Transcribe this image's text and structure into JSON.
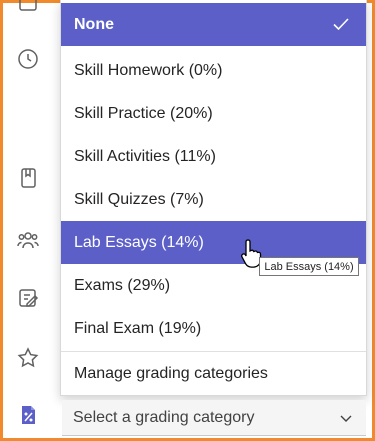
{
  "grading_menu": {
    "items": [
      {
        "label": "None",
        "state": "selected"
      },
      {
        "label": "Skill Homework (0%)",
        "state": "normal"
      },
      {
        "label": "Skill Practice (20%)",
        "state": "normal"
      },
      {
        "label": "Skill Activities (11%)",
        "state": "normal"
      },
      {
        "label": "Skill Quizzes (7%)",
        "state": "normal"
      },
      {
        "label": "Lab Essays (14%)",
        "state": "hover"
      },
      {
        "label": "Exams (29%)",
        "state": "normal"
      },
      {
        "label": "Final Exam (19%)",
        "state": "normal"
      }
    ],
    "manage_label": "Manage grading categories"
  },
  "select": {
    "placeholder": "Select a grading category"
  },
  "tooltip": {
    "text": "Lab Essays (14%)"
  },
  "rail_icons": [
    "clock-icon",
    "notebook-icon",
    "people-icon",
    "edit-icon",
    "star-icon",
    "grades-icon"
  ],
  "colors": {
    "accent": "#5b5fc7",
    "frame": "#f08a2c",
    "icon": "#616161"
  }
}
